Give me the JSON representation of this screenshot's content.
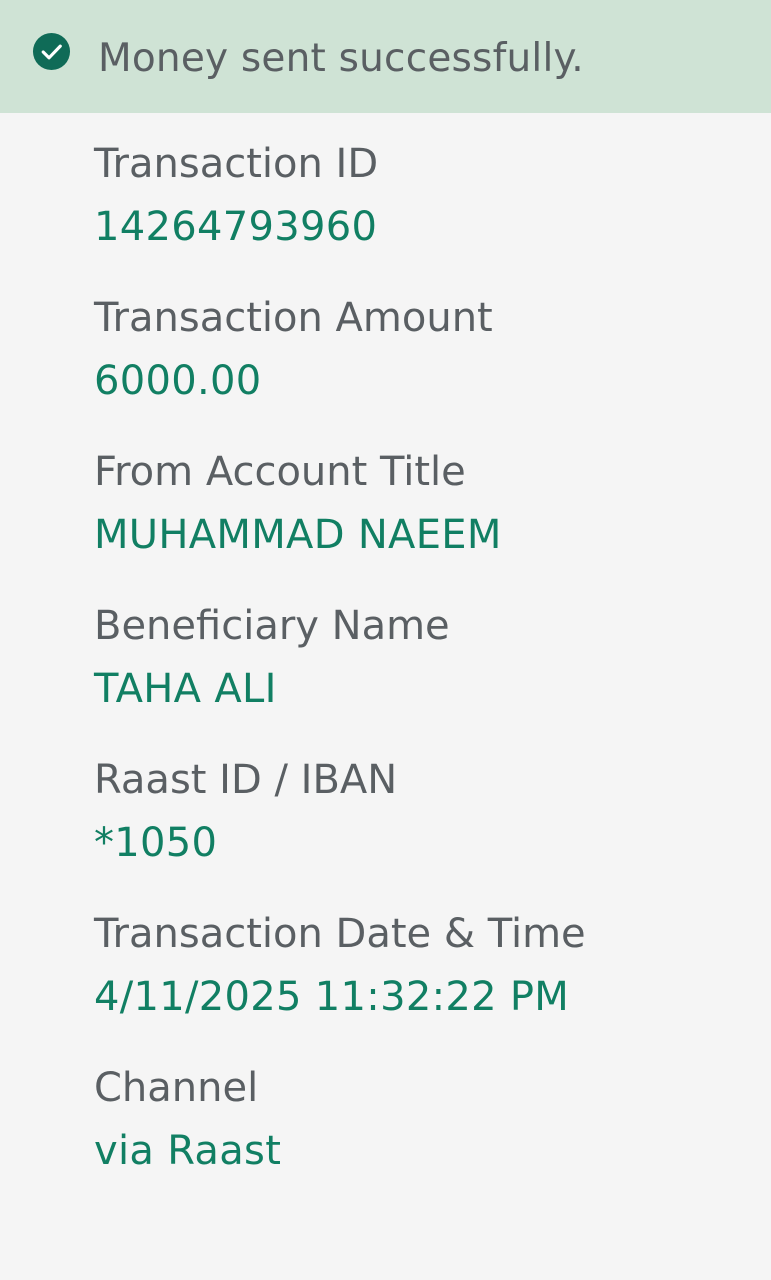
{
  "banner": {
    "message": "Money sent successfully.",
    "icon": "check-circle-icon",
    "background": "#cfe3d5",
    "icon_color": "#0f6b57"
  },
  "fields": [
    {
      "label": "Transaction ID",
      "value": "14264793960"
    },
    {
      "label": "Transaction Amount",
      "value": "6000.00"
    },
    {
      "label": "From Account Title",
      "value": "MUHAMMAD NAEEM"
    },
    {
      "label": "Beneficiary Name",
      "value": "TAHA ALI"
    },
    {
      "label": "Raast ID / IBAN",
      "value": "*1050"
    },
    {
      "label": "Transaction Date & Time",
      "value": "4/11/2025 11:32:22 PM"
    },
    {
      "label": "Channel",
      "value": "via Raast"
    }
  ],
  "colors": {
    "label": "#5a5f63",
    "value": "#117f63",
    "page_background": "#f5f5f5"
  }
}
